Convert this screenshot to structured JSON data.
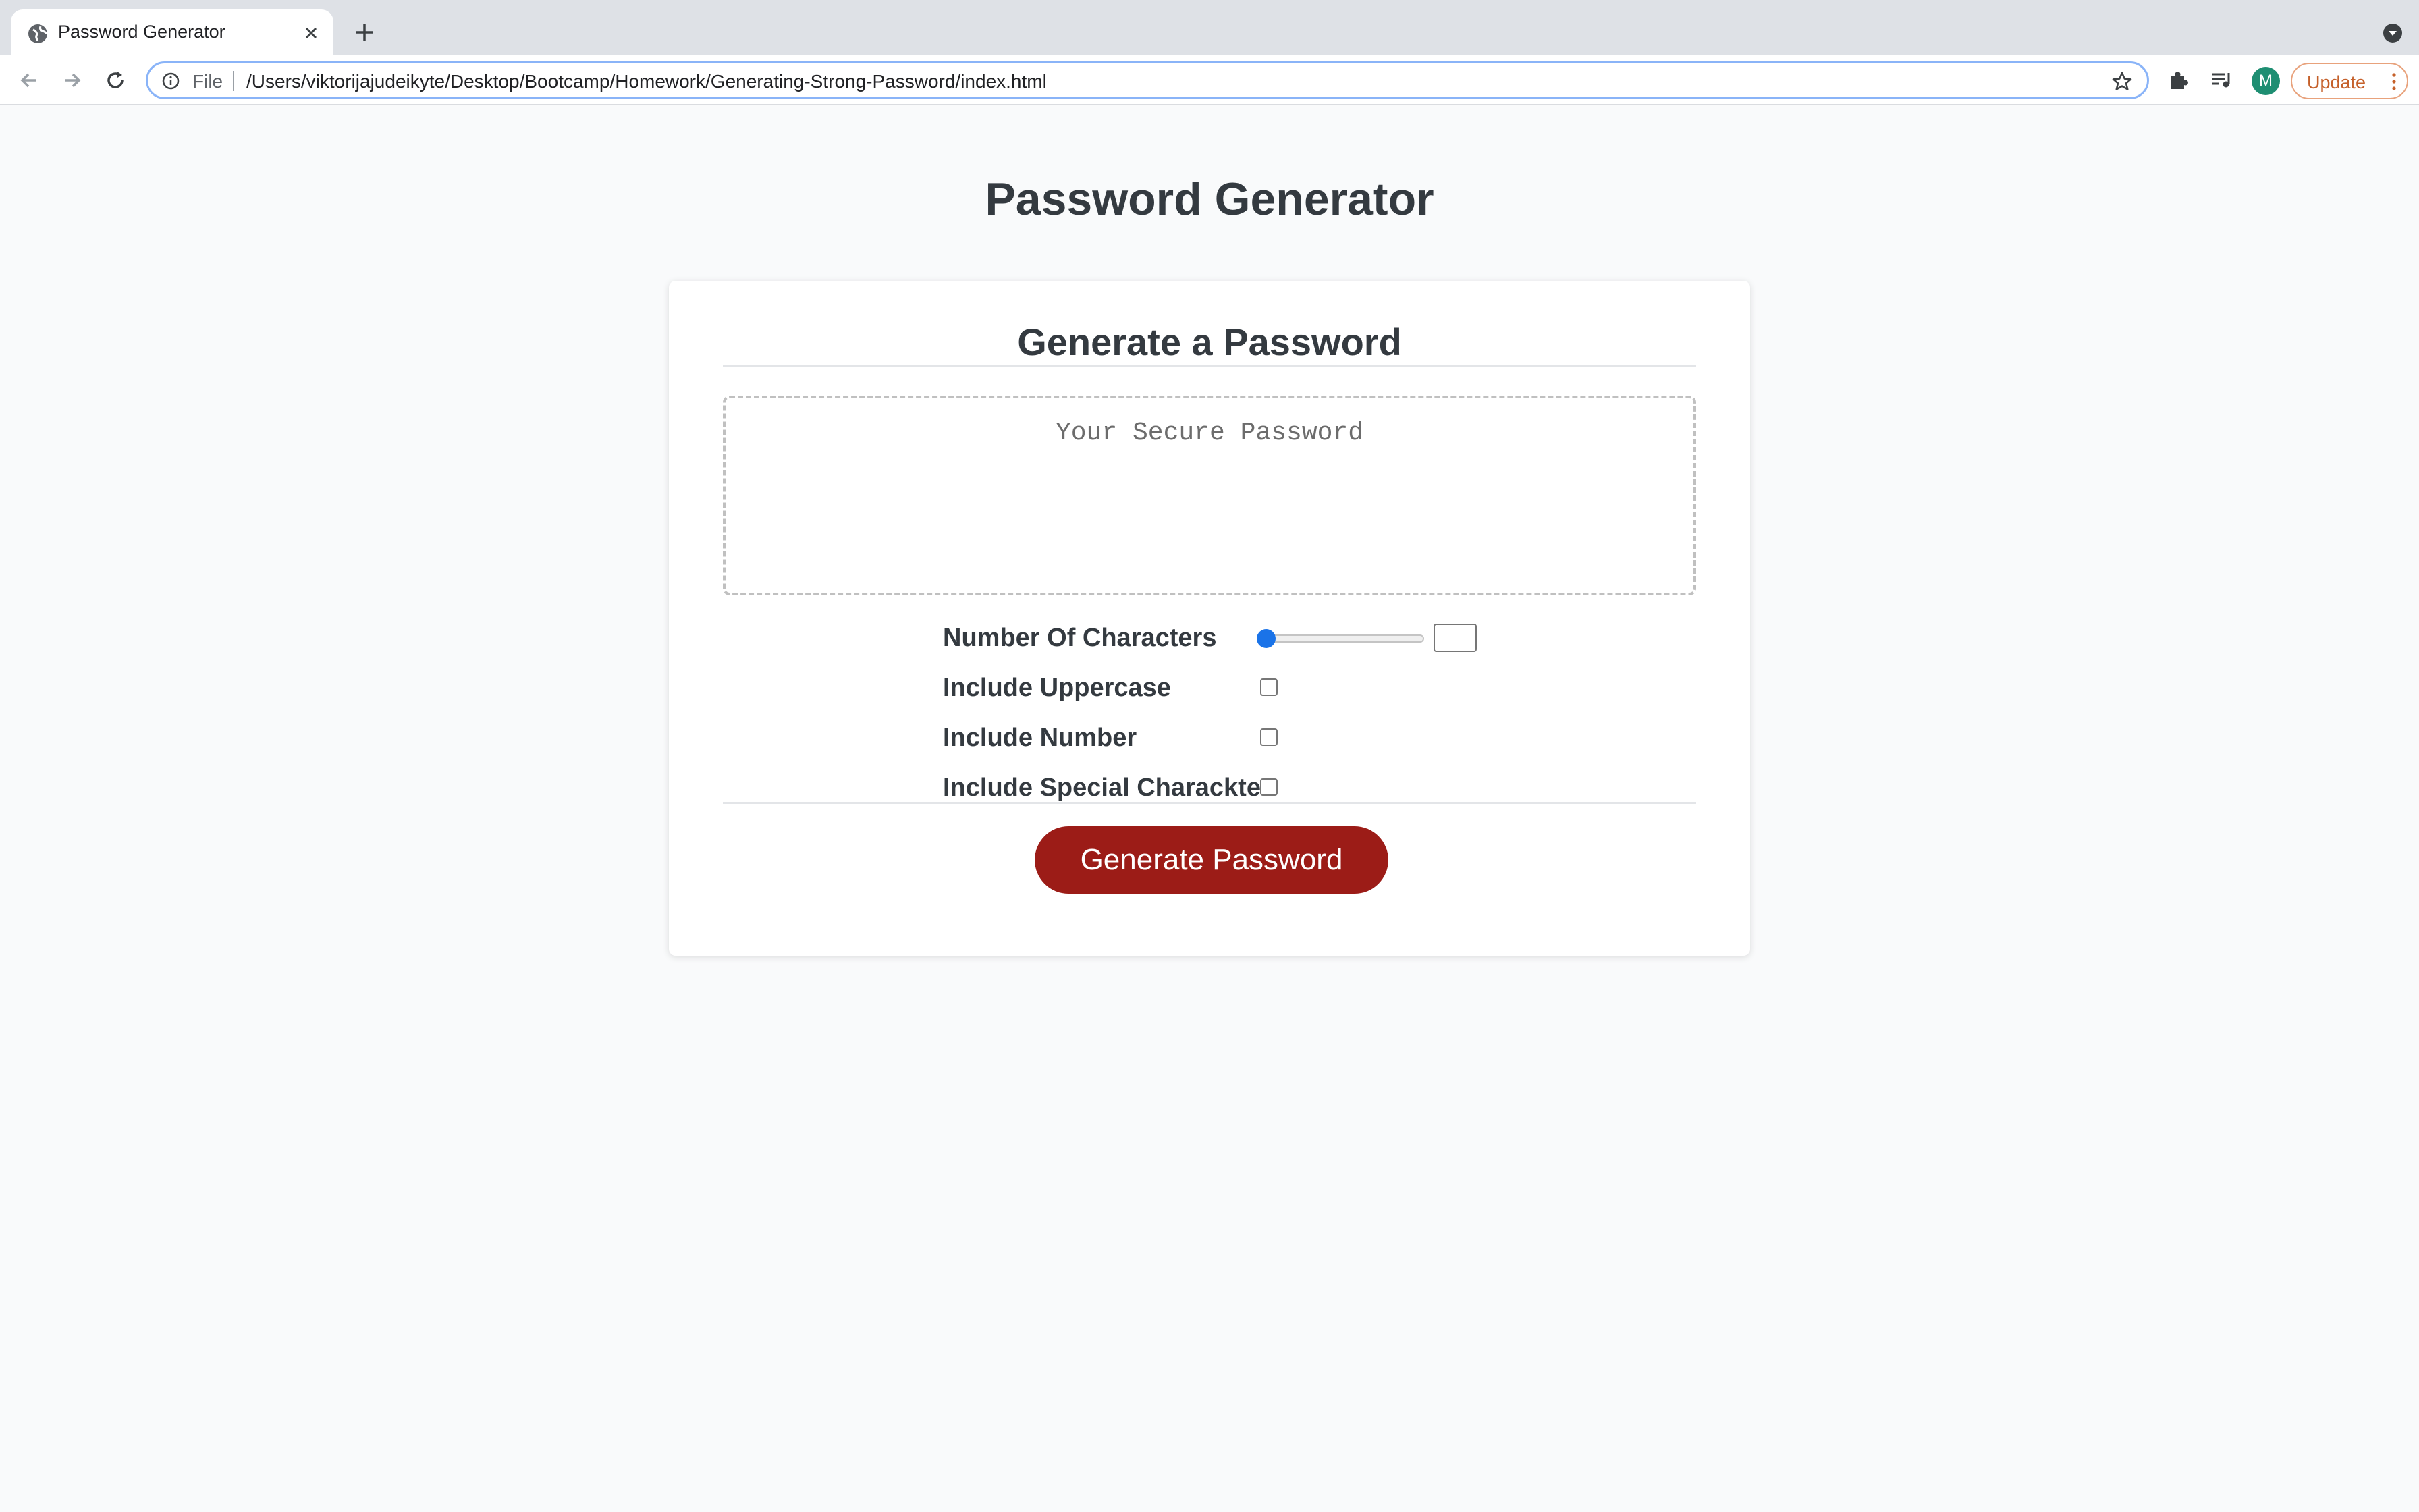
{
  "browser": {
    "tab_title": "Password Generator",
    "url_scheme": "File",
    "url": "/Users/viktorijajudeikyte/Desktop/Bootcamp/Homework/Generating-Strong-Password/index.html",
    "avatar_letter": "M",
    "update_label": "Update",
    "accent_color": "#1a73e8"
  },
  "page": {
    "title": "Password Generator"
  },
  "card": {
    "title": "Generate a Password",
    "password_placeholder": "Your Secure Password",
    "options": {
      "length_label": "Number Of Characters",
      "length_slider_level": 0,
      "length_value": "",
      "uppercase_label": "Include Uppercase",
      "uppercase_checked": false,
      "number_label": "Include Number",
      "number_checked": false,
      "special_label": "Include Special Charackter",
      "special_checked": false
    },
    "generate_button": "Generate Password",
    "button_color": "#9c1c17"
  }
}
